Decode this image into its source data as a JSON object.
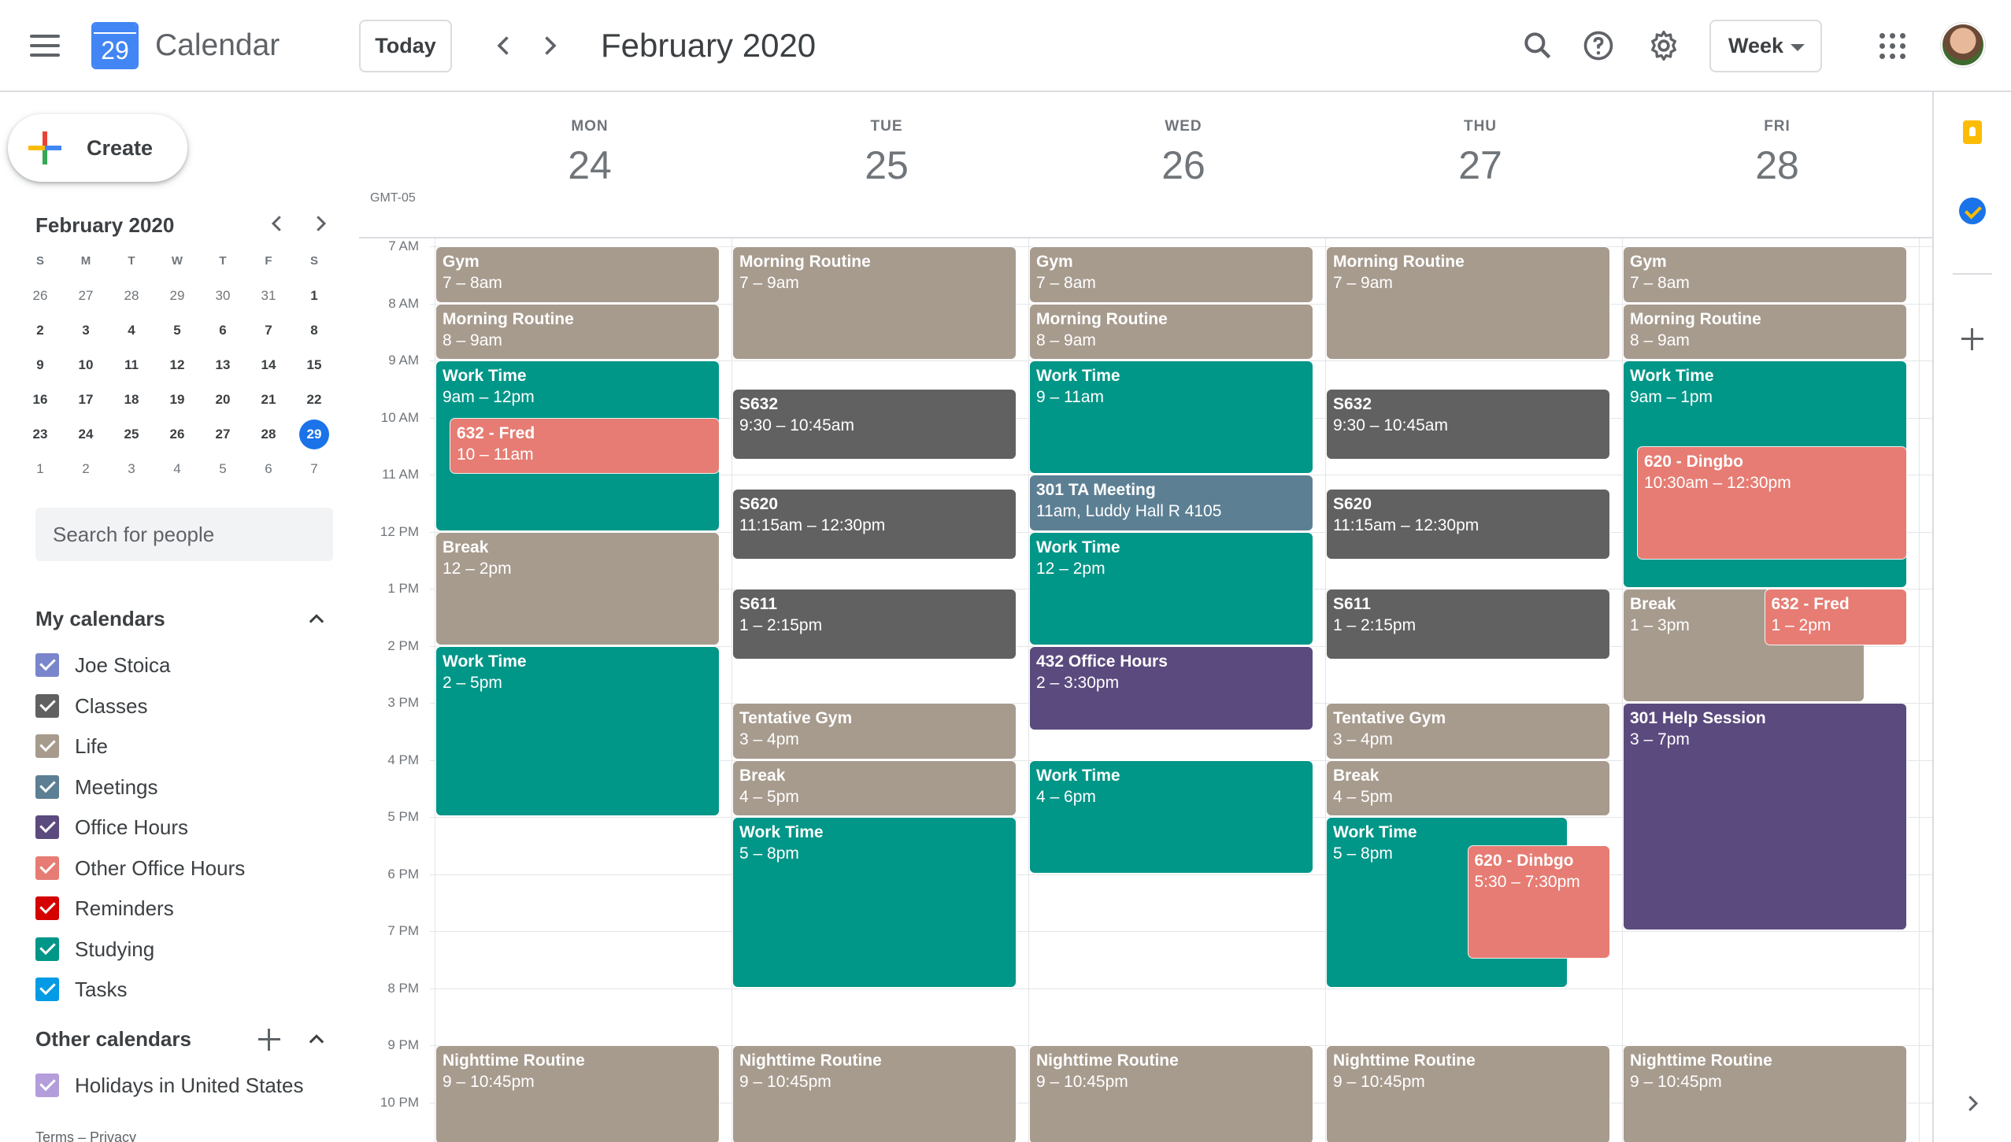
{
  "header": {
    "app_title": "Calendar",
    "logo_day": "29",
    "today_label": "Today",
    "current_range": "February 2020",
    "view_label": "Week"
  },
  "sidebar": {
    "create_label": "Create",
    "mini_month_title": "February 2020",
    "mini_dow": [
      "S",
      "M",
      "T",
      "W",
      "T",
      "F",
      "S"
    ],
    "mini_weeks": [
      [
        "26",
        "27",
        "28",
        "29",
        "30",
        "31",
        "1"
      ],
      [
        "2",
        "3",
        "4",
        "5",
        "6",
        "7",
        "8"
      ],
      [
        "9",
        "10",
        "11",
        "12",
        "13",
        "14",
        "15"
      ],
      [
        "16",
        "17",
        "18",
        "19",
        "20",
        "21",
        "22"
      ],
      [
        "23",
        "24",
        "25",
        "26",
        "27",
        "28",
        "29"
      ],
      [
        "1",
        "2",
        "3",
        "4",
        "5",
        "6",
        "7"
      ]
    ],
    "mini_today": "29",
    "search_people_placeholder": "Search for people",
    "my_calendars_title": "My calendars",
    "my_calendars": [
      {
        "label": "Joe Stoica",
        "color": "#7986cb"
      },
      {
        "label": "Classes",
        "color": "#616161"
      },
      {
        "label": "Life",
        "color": "#a79b8e"
      },
      {
        "label": "Meetings",
        "color": "#5c7f94"
      },
      {
        "label": "Office Hours",
        "color": "#5b4a7e"
      },
      {
        "label": "Other Office Hours",
        "color": "#e67c73"
      },
      {
        "label": "Reminders",
        "color": "#d50000"
      },
      {
        "label": "Studying",
        "color": "#009688"
      },
      {
        "label": "Tasks",
        "color": "#039be5"
      }
    ],
    "other_calendars_title": "Other calendars",
    "other_calendars": [
      {
        "label": "Holidays in United States",
        "color": "#b39ddb"
      }
    ],
    "footer": "Terms – Privacy"
  },
  "week": {
    "timezone": "GMT-05",
    "days": [
      {
        "dow": "MON",
        "num": "24"
      },
      {
        "dow": "TUE",
        "num": "25"
      },
      {
        "dow": "WED",
        "num": "26"
      },
      {
        "dow": "THU",
        "num": "27"
      },
      {
        "dow": "FRI",
        "num": "28"
      }
    ],
    "hours": [
      "7 AM",
      "8 AM",
      "9 AM",
      "10 AM",
      "11 AM",
      "12 PM",
      "1 PM",
      "2 PM",
      "3 PM",
      "4 PM",
      "5 PM",
      "6 PM",
      "7 PM",
      "8 PM",
      "9 PM",
      "10 PM"
    ]
  },
  "colors": {
    "life": "#a79b8e",
    "studying": "#009688",
    "classes": "#616161",
    "other_office_hours": "#e67c73",
    "meetings": "#5c7f94",
    "office_hours": "#5b4a7e"
  },
  "events": [
    {
      "day": 0,
      "title": "Gym",
      "time": "7 – 8am",
      "start": 7,
      "end": 8,
      "cal": "life"
    },
    {
      "day": 0,
      "title": "Morning Routine",
      "time": "8 – 9am",
      "start": 8,
      "end": 9,
      "cal": "life"
    },
    {
      "day": 0,
      "title": "Work Time",
      "time": "9am – 12pm",
      "start": 9,
      "end": 12,
      "cal": "studying"
    },
    {
      "day": 0,
      "title": "632 - Fred",
      "time": "10 – 11am",
      "start": 10,
      "end": 11,
      "cal": "other_office_hours",
      "indent": 0.05
    },
    {
      "day": 0,
      "title": "Break",
      "time": "12 – 2pm",
      "start": 12,
      "end": 14,
      "cal": "life"
    },
    {
      "day": 0,
      "title": "Work Time",
      "time": "2 – 5pm",
      "start": 14,
      "end": 17,
      "cal": "studying"
    },
    {
      "day": 0,
      "title": "Nighttime Routine",
      "time": "9 – 10:45pm",
      "start": 21,
      "end": 22.75,
      "cal": "life"
    },
    {
      "day": 1,
      "title": "Morning Routine",
      "time": "7 – 9am",
      "start": 7,
      "end": 9,
      "cal": "life"
    },
    {
      "day": 1,
      "title": "S632",
      "time": "9:30 – 10:45am",
      "start": 9.5,
      "end": 10.75,
      "cal": "classes"
    },
    {
      "day": 1,
      "title": "S620",
      "time": "11:15am – 12:30pm",
      "start": 11.25,
      "end": 12.5,
      "cal": "classes"
    },
    {
      "day": 1,
      "title": "S611",
      "time": "1 – 2:15pm",
      "start": 13,
      "end": 14.25,
      "cal": "classes"
    },
    {
      "day": 1,
      "title": "Tentative Gym",
      "time": "3 – 4pm",
      "start": 15,
      "end": 16,
      "cal": "life"
    },
    {
      "day": 1,
      "title": "Break",
      "time": "4 – 5pm",
      "start": 16,
      "end": 17,
      "cal": "life"
    },
    {
      "day": 1,
      "title": "Work Time",
      "time": "5 – 8pm",
      "start": 17,
      "end": 20,
      "cal": "studying"
    },
    {
      "day": 1,
      "title": "Nighttime Routine",
      "time": "9 – 10:45pm",
      "start": 21,
      "end": 22.75,
      "cal": "life"
    },
    {
      "day": 2,
      "title": "Gym",
      "time": "7 – 8am",
      "start": 7,
      "end": 8,
      "cal": "life"
    },
    {
      "day": 2,
      "title": "Morning Routine",
      "time": "8 – 9am",
      "start": 8,
      "end": 9,
      "cal": "life"
    },
    {
      "day": 2,
      "title": "Work Time",
      "time": "9 – 11am",
      "start": 9,
      "end": 11,
      "cal": "studying"
    },
    {
      "day": 2,
      "title": "301 TA Meeting",
      "time": "11am, Luddy Hall R 4105",
      "start": 11,
      "end": 12,
      "cal": "meetings"
    },
    {
      "day": 2,
      "title": "Work Time",
      "time": "12 – 2pm",
      "start": 12,
      "end": 14,
      "cal": "studying"
    },
    {
      "day": 2,
      "title": "432 Office Hours",
      "time": "2 – 3:30pm",
      "start": 14,
      "end": 15.5,
      "cal": "office_hours"
    },
    {
      "day": 2,
      "title": "Work Time",
      "time": "4 – 6pm",
      "start": 16,
      "end": 18,
      "cal": "studying"
    },
    {
      "day": 2,
      "title": "Nighttime Routine",
      "time": "9 – 10:45pm",
      "start": 21,
      "end": 22.75,
      "cal": "life"
    },
    {
      "day": 3,
      "title": "Morning Routine",
      "time": "7 – 9am",
      "start": 7,
      "end": 9,
      "cal": "life"
    },
    {
      "day": 3,
      "title": "S632",
      "time": "9:30 – 10:45am",
      "start": 9.5,
      "end": 10.75,
      "cal": "classes"
    },
    {
      "day": 3,
      "title": "S620",
      "time": "11:15am – 12:30pm",
      "start": 11.25,
      "end": 12.5,
      "cal": "classes"
    },
    {
      "day": 3,
      "title": "S611",
      "time": "1 – 2:15pm",
      "start": 13,
      "end": 14.25,
      "cal": "classes"
    },
    {
      "day": 3,
      "title": "Tentative Gym",
      "time": "3 – 4pm",
      "start": 15,
      "end": 16,
      "cal": "life"
    },
    {
      "day": 3,
      "title": "Break",
      "time": "4 – 5pm",
      "start": 16,
      "end": 17,
      "cal": "life"
    },
    {
      "day": 3,
      "title": "Work Time",
      "time": "5 – 8pm",
      "start": 17,
      "end": 20,
      "cal": "studying",
      "width": 0.85
    },
    {
      "day": 3,
      "title": "620 - Dinbgo",
      "time": "5:30 – 7:30pm",
      "start": 17.5,
      "end": 19.5,
      "cal": "other_office_hours",
      "indent": 0.5
    },
    {
      "day": 3,
      "title": "Nighttime Routine",
      "time": "9 – 10:45pm",
      "start": 21,
      "end": 22.75,
      "cal": "life"
    },
    {
      "day": 4,
      "title": "Gym",
      "time": "7 – 8am",
      "start": 7,
      "end": 8,
      "cal": "life"
    },
    {
      "day": 4,
      "title": "Morning Routine",
      "time": "8 – 9am",
      "start": 8,
      "end": 9,
      "cal": "life"
    },
    {
      "day": 4,
      "title": "Work Time",
      "time": "9am – 1pm",
      "start": 9,
      "end": 13,
      "cal": "studying"
    },
    {
      "day": 4,
      "title": "620 - Dingbo",
      "time": "10:30am – 12:30pm",
      "start": 10.5,
      "end": 12.5,
      "cal": "other_office_hours",
      "indent": 0.05
    },
    {
      "day": 4,
      "title": "Break",
      "time": "1 – 3pm",
      "start": 13,
      "end": 15,
      "cal": "life",
      "width": 0.85
    },
    {
      "day": 4,
      "title": "632 - Fred",
      "time": "1 – 2pm",
      "start": 13,
      "end": 14,
      "cal": "other_office_hours",
      "indent": 0.5
    },
    {
      "day": 4,
      "title": "301 Help Session",
      "time": "3 – 7pm",
      "start": 15,
      "end": 19,
      "cal": "office_hours"
    },
    {
      "day": 4,
      "title": "Nighttime Routine",
      "time": "9 – 10:45pm",
      "start": 21,
      "end": 22.75,
      "cal": "life"
    }
  ]
}
